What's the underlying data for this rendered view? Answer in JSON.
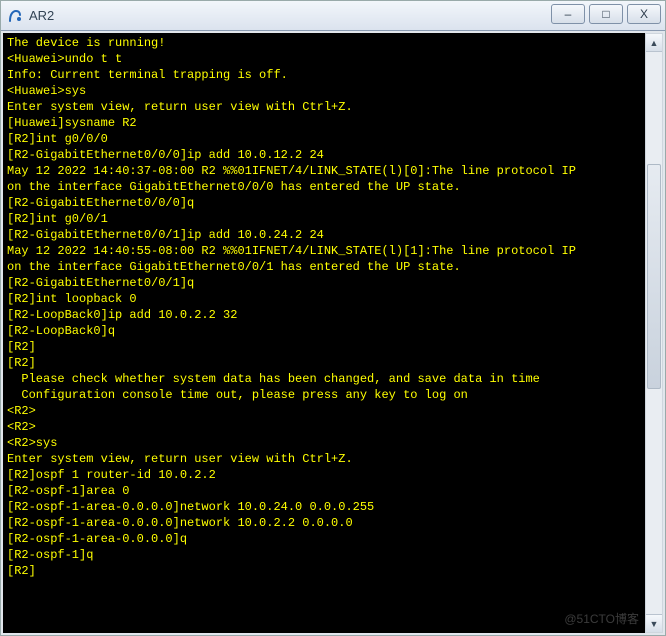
{
  "window": {
    "title": "AR2",
    "icon_name": "ensp-icon",
    "controls": {
      "min_label": "–",
      "max_label": "□",
      "close_label": "X"
    }
  },
  "watermark": "@51CTO博客",
  "terminal": {
    "lines": [
      "The device is running!",
      "",
      "<Huawei>undo t t",
      "Info: Current terminal trapping is off.",
      "<Huawei>sys",
      "Enter system view, return user view with Ctrl+Z.",
      "[Huawei]sysname R2",
      "[R2]int g0/0/0",
      "[R2-GigabitEthernet0/0/0]ip add 10.0.12.2 24",
      "May 12 2022 14:40:37-08:00 R2 %%01IFNET/4/LINK_STATE(l)[0]:The line protocol IP",
      "on the interface GigabitEthernet0/0/0 has entered the UP state.",
      "[R2-GigabitEthernet0/0/0]q",
      "[R2]int g0/0/1",
      "[R2-GigabitEthernet0/0/1]ip add 10.0.24.2 24",
      "May 12 2022 14:40:55-08:00 R2 %%01IFNET/4/LINK_STATE(l)[1]:The line protocol IP",
      "on the interface GigabitEthernet0/0/1 has entered the UP state.",
      "[R2-GigabitEthernet0/0/1]q",
      "[R2]int loopback 0",
      "[R2-LoopBack0]ip add 10.0.2.2 32",
      "[R2-LoopBack0]q",
      "[R2]",
      "[R2]",
      "",
      "  Please check whether system data has been changed, and save data in time",
      "",
      "  Configuration console time out, please press any key to log on",
      "",
      "<R2>",
      "<R2>",
      "<R2>sys",
      "Enter system view, return user view with Ctrl+Z.",
      "[R2]ospf 1 router-id 10.0.2.2",
      "[R2-ospf-1]area 0",
      "[R2-ospf-1-area-0.0.0.0]network 10.0.24.0 0.0.0.255",
      "[R2-ospf-1-area-0.0.0.0]network 10.0.2.2 0.0.0.0",
      "[R2-ospf-1-area-0.0.0.0]q",
      "[R2-ospf-1]q",
      "[R2]"
    ]
  }
}
